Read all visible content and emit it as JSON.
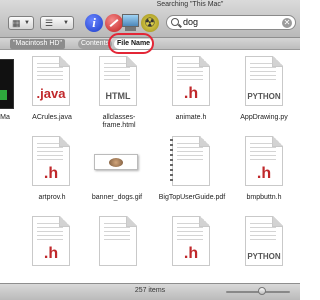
{
  "window": {
    "title": "Searching \"This Mac\""
  },
  "search": {
    "value": "dog",
    "clear_glyph": "✕"
  },
  "toolbar": {
    "info_glyph": "i"
  },
  "scope": {
    "location": "\"Macintosh HD\"",
    "contents_label": "Contents",
    "filename_label": "File Name",
    "highlight_color": "#e32636"
  },
  "files": [
    {
      "name": "Ma",
      "kind": "terminal"
    },
    {
      "name": "ACrules.java",
      "kind": "doc",
      "badge": ".java"
    },
    {
      "name": "allclasses-\nframe.html",
      "kind": "doc",
      "badge": "HTML"
    },
    {
      "name": "animate.h",
      "kind": "doc",
      "badge": ".h"
    },
    {
      "name": "AppDrawing.py",
      "kind": "doc",
      "badge": "PYTHON"
    },
    {
      "name": "artprov.h",
      "kind": "doc",
      "badge": ".h"
    },
    {
      "name": "banner_dogs.gif",
      "kind": "image"
    },
    {
      "name": "BigTopUserGuide.pdf",
      "kind": "doc"
    },
    {
      "name": "bmpbuttn.h",
      "kind": "doc",
      "badge": ".h"
    },
    {
      "name": "",
      "kind": "doc"
    },
    {
      "name": "",
      "kind": "doc",
      "badge": ".h"
    },
    {
      "name": "",
      "kind": "doc",
      "badge": "PYTHON"
    },
    {
      "name": "",
      "kind": "doc",
      "badge": ".h"
    }
  ],
  "status": {
    "text": "257 items"
  }
}
